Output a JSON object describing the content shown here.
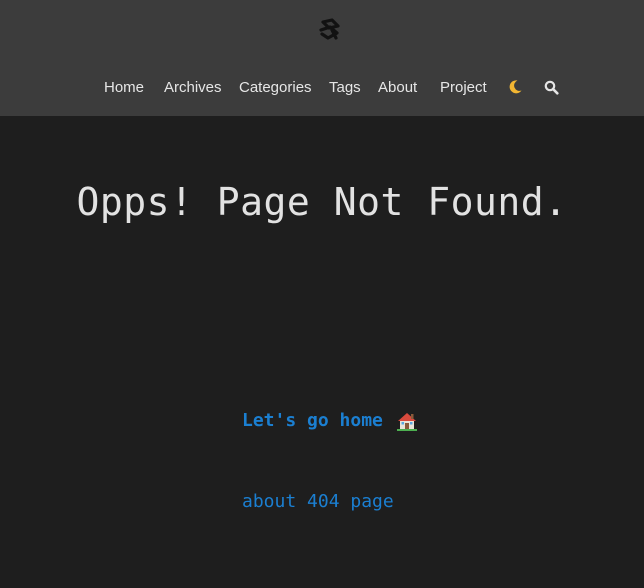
{
  "header": {
    "logo_icon": "site-logo-icon",
    "nav": {
      "home": "Home",
      "archives": "Archives",
      "categories": "Categories",
      "tags": "Tags",
      "about": "About",
      "project": "Project"
    },
    "theme_toggle_icon": "moon-icon",
    "search_icon": "search-icon"
  },
  "main": {
    "title": "Opps! Page Not Found.",
    "home_link": "Let's go home",
    "home_link_icon": "house-icon",
    "about_link": "about 404 page"
  },
  "colors": {
    "header_bg": "#3c3c3c",
    "page_bg": "#1e1e1e",
    "link": "#1b7fd1",
    "moon": "#f2b632"
  }
}
